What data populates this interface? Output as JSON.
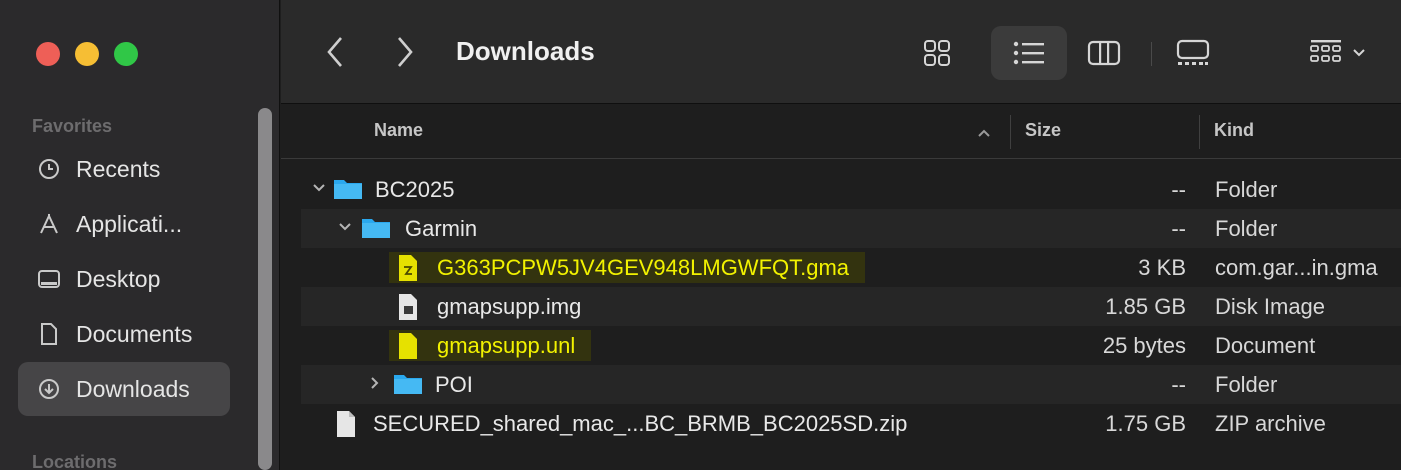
{
  "sidebar": {
    "favorites_label": "Favorites",
    "locations_label": "Locations",
    "items": [
      {
        "label": "Recents",
        "icon": "clock-icon"
      },
      {
        "label": "Applicati...",
        "icon": "applications-icon"
      },
      {
        "label": "Desktop",
        "icon": "desktop-icon"
      },
      {
        "label": "Documents",
        "icon": "document-icon"
      },
      {
        "label": "Downloads",
        "icon": "download-icon",
        "active": true
      }
    ]
  },
  "toolbar": {
    "title": "Downloads"
  },
  "columns": {
    "name": "Name",
    "size": "Size",
    "kind": "Kind"
  },
  "files": [
    {
      "name": "BC2025",
      "size": "--",
      "kind": "Folder",
      "type": "folder",
      "expanded": true,
      "depth": 0
    },
    {
      "name": "Garmin",
      "size": "--",
      "kind": "Folder",
      "type": "folder",
      "expanded": true,
      "depth": 1
    },
    {
      "name": "G363PCPW5JV4GEV948LMGWFQT.gma",
      "size": "3 KB",
      "kind": "com.gar...in.gma",
      "type": "file",
      "highlighted": true,
      "depth": 2
    },
    {
      "name": "gmapsupp.img",
      "size": "1.85 GB",
      "kind": "Disk Image",
      "type": "file",
      "depth": 2
    },
    {
      "name": "gmapsupp.unl",
      "size": "25 bytes",
      "kind": "Document",
      "type": "file",
      "highlighted": true,
      "depth": 2
    },
    {
      "name": "POI",
      "size": "--",
      "kind": "Folder",
      "type": "folder",
      "expanded": false,
      "depth": 1
    },
    {
      "name": "SECURED_shared_mac_...BC_BRMB_BC2025SD.zip",
      "size": "1.75 GB",
      "kind": "ZIP archive",
      "type": "file",
      "depth": 0
    }
  ],
  "colors": {
    "highlight_text": "#f2f200",
    "highlight_bg": "#33330f",
    "folder_blue": "#2aa8ee",
    "red": "#ee5f57",
    "yellow": "#f6be34",
    "green": "#30c747"
  }
}
